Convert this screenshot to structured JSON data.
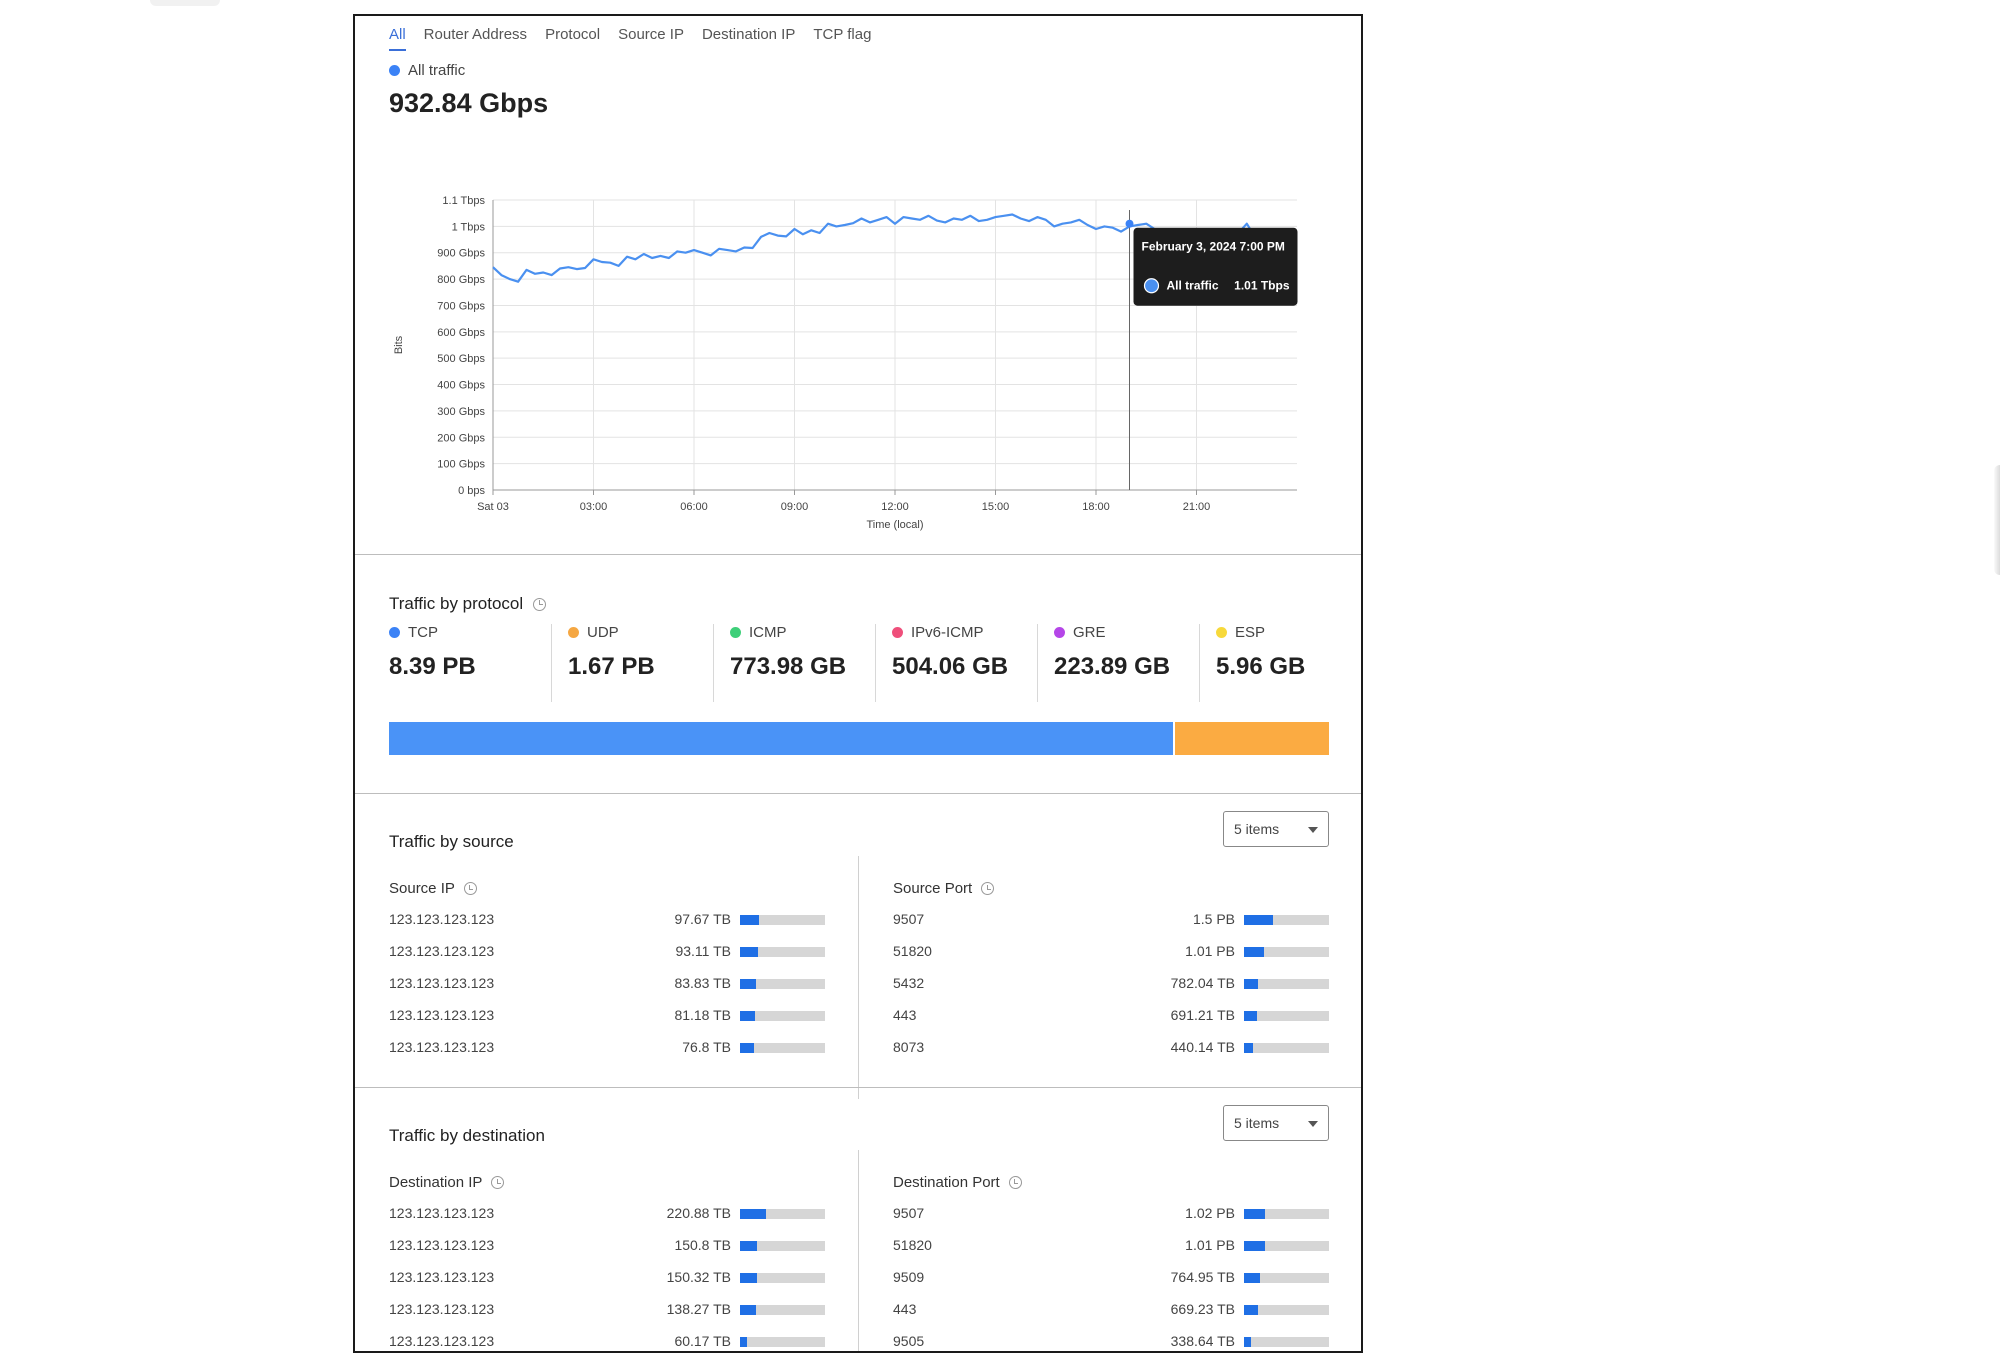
{
  "tabs": [
    "All",
    "Router Address",
    "Protocol",
    "Source IP",
    "Destination IP",
    "TCP flag"
  ],
  "legend": {
    "label": "All traffic",
    "color": "#3b82f6"
  },
  "total_value": "932.84 Gbps",
  "chart_data": {
    "type": "line",
    "ylabel": "Bits",
    "xlabel": "Time (local)",
    "y_unit": "Gbps",
    "ylim": [
      0,
      1100
    ],
    "y_ticks": [
      {
        "v": 1100,
        "label": "1.1 Tbps"
      },
      {
        "v": 1000,
        "label": "1 Tbps"
      },
      {
        "v": 900,
        "label": "900 Gbps"
      },
      {
        "v": 800,
        "label": "800 Gbps"
      },
      {
        "v": 700,
        "label": "700 Gbps"
      },
      {
        "v": 600,
        "label": "600 Gbps"
      },
      {
        "v": 500,
        "label": "500 Gbps"
      },
      {
        "v": 400,
        "label": "400 Gbps"
      },
      {
        "v": 300,
        "label": "300 Gbps"
      },
      {
        "v": 200,
        "label": "200 Gbps"
      },
      {
        "v": 100,
        "label": "100 Gbps"
      },
      {
        "v": 0,
        "label": "0 bps"
      }
    ],
    "x_unit": "hours",
    "xlim": [
      0,
      24
    ],
    "x_ticks": [
      {
        "v": 0,
        "label": "Sat 03"
      },
      {
        "v": 3,
        "label": "03:00"
      },
      {
        "v": 6,
        "label": "06:00"
      },
      {
        "v": 9,
        "label": "09:00"
      },
      {
        "v": 12,
        "label": "12:00"
      },
      {
        "v": 15,
        "label": "15:00"
      },
      {
        "v": 18,
        "label": "18:00"
      },
      {
        "v": 21,
        "label": "21:00"
      }
    ],
    "grid": true,
    "series": [
      {
        "name": "All traffic",
        "color": "#4a90f0",
        "x": [
          0,
          0.25,
          0.5,
          0.75,
          1,
          1.25,
          1.5,
          1.75,
          2,
          2.25,
          2.5,
          2.75,
          3,
          3.25,
          3.5,
          3.75,
          4,
          4.25,
          4.5,
          4.75,
          5,
          5.25,
          5.5,
          5.75,
          6,
          6.25,
          6.5,
          6.75,
          7,
          7.25,
          7.5,
          7.75,
          8,
          8.25,
          8.5,
          8.75,
          9,
          9.25,
          9.5,
          9.75,
          10,
          10.25,
          10.5,
          10.75,
          11,
          11.25,
          11.5,
          11.75,
          12,
          12.25,
          12.5,
          12.75,
          13,
          13.25,
          13.5,
          13.75,
          14,
          14.25,
          14.5,
          14.75,
          15,
          15.25,
          15.5,
          15.75,
          16,
          16.25,
          16.5,
          16.75,
          17,
          17.25,
          17.5,
          17.75,
          18,
          18.25,
          18.5,
          18.75,
          19,
          19.25,
          19.5,
          19.75,
          20,
          20.25,
          20.5,
          20.75,
          21,
          21.25,
          21.5,
          21.75,
          22,
          22.25,
          22.5,
          22.75,
          23
        ],
        "y": [
          845,
          815,
          800,
          790,
          835,
          820,
          825,
          815,
          840,
          845,
          838,
          842,
          875,
          865,
          862,
          850,
          885,
          875,
          895,
          880,
          888,
          880,
          905,
          900,
          910,
          900,
          890,
          915,
          910,
          905,
          920,
          918,
          960,
          975,
          965,
          962,
          990,
          970,
          985,
          975,
          1010,
          1000,
          1005,
          1012,
          1030,
          1015,
          1025,
          1035,
          1010,
          1035,
          1030,
          1025,
          1040,
          1022,
          1015,
          1030,
          1025,
          1040,
          1020,
          1025,
          1035,
          1040,
          1045,
          1030,
          1020,
          1035,
          1025,
          1000,
          1010,
          1015,
          1025,
          1005,
          990,
          1000,
          995,
          980,
          1000,
          1005,
          1010,
          990,
          985,
          970,
          960,
          975,
          955,
          965,
          940,
          920,
          960,
          975,
          1010,
          960,
          955
        ]
      }
    ],
    "hover": {
      "x": 19,
      "y": 1010
    },
    "tooltip": {
      "title": "February 3, 2024 7:00 PM",
      "series": "All traffic",
      "value": "1.01 Tbps"
    }
  },
  "protocol_section": {
    "title": "Traffic by protocol",
    "items": [
      {
        "name": "TCP",
        "value": "8.39 PB",
        "color": "#3b82f6"
      },
      {
        "name": "UDP",
        "value": "1.67 PB",
        "color": "#f5a742"
      },
      {
        "name": "ICMP",
        "value": "773.98 GB",
        "color": "#3ecf79"
      },
      {
        "name": "IPv6-ICMP",
        "value": "504.06 GB",
        "color": "#ef4f7b"
      },
      {
        "name": "GRE",
        "value": "223.89 GB",
        "color": "#b546e8"
      },
      {
        "name": "ESP",
        "value": "5.96 GB",
        "color": "#f7d93b"
      }
    ],
    "bar_fractions": [
      {
        "color": "#4a93f7",
        "fraction": 0.834
      },
      {
        "color": "#fbab42",
        "fraction": 0.166
      }
    ]
  },
  "source_section": {
    "title": "Traffic by source",
    "select_value": "5 items",
    "ip_title": "Source IP",
    "port_title": "Source Port",
    "ips": [
      {
        "label": "123.123.123.123",
        "value": "97.67 TB",
        "fraction": 0.22
      },
      {
        "label": "123.123.123.123",
        "value": "93.11 TB",
        "fraction": 0.21
      },
      {
        "label": "123.123.123.123",
        "value": "83.83 TB",
        "fraction": 0.19
      },
      {
        "label": "123.123.123.123",
        "value": "81.18 TB",
        "fraction": 0.18
      },
      {
        "label": "123.123.123.123",
        "value": "76.8 TB",
        "fraction": 0.17
      }
    ],
    "ports": [
      {
        "label": "9507",
        "value": "1.5 PB",
        "fraction": 0.34
      },
      {
        "label": "51820",
        "value": "1.01 PB",
        "fraction": 0.23
      },
      {
        "label": "5432",
        "value": "782.04 TB",
        "fraction": 0.17
      },
      {
        "label": "443",
        "value": "691.21 TB",
        "fraction": 0.15
      },
      {
        "label": "8073",
        "value": "440.14 TB",
        "fraction": 0.1
      }
    ]
  },
  "destination_section": {
    "title": "Traffic by destination",
    "select_value": "5 items",
    "ip_title": "Destination IP",
    "port_title": "Destination Port",
    "ips": [
      {
        "label": "123.123.123.123",
        "value": "220.88 TB",
        "fraction": 0.3
      },
      {
        "label": "123.123.123.123",
        "value": "150.8 TB",
        "fraction": 0.2
      },
      {
        "label": "123.123.123.123",
        "value": "150.32 TB",
        "fraction": 0.2
      },
      {
        "label": "123.123.123.123",
        "value": "138.27 TB",
        "fraction": 0.19
      },
      {
        "label": "123.123.123.123",
        "value": "60.17 TB",
        "fraction": 0.08
      }
    ],
    "ports": [
      {
        "label": "9507",
        "value": "1.02 PB",
        "fraction": 0.25
      },
      {
        "label": "51820",
        "value": "1.01 PB",
        "fraction": 0.25
      },
      {
        "label": "9509",
        "value": "764.95 TB",
        "fraction": 0.19
      },
      {
        "label": "443",
        "value": "669.23 TB",
        "fraction": 0.16
      },
      {
        "label": "9505",
        "value": "338.64 TB",
        "fraction": 0.08
      }
    ]
  }
}
